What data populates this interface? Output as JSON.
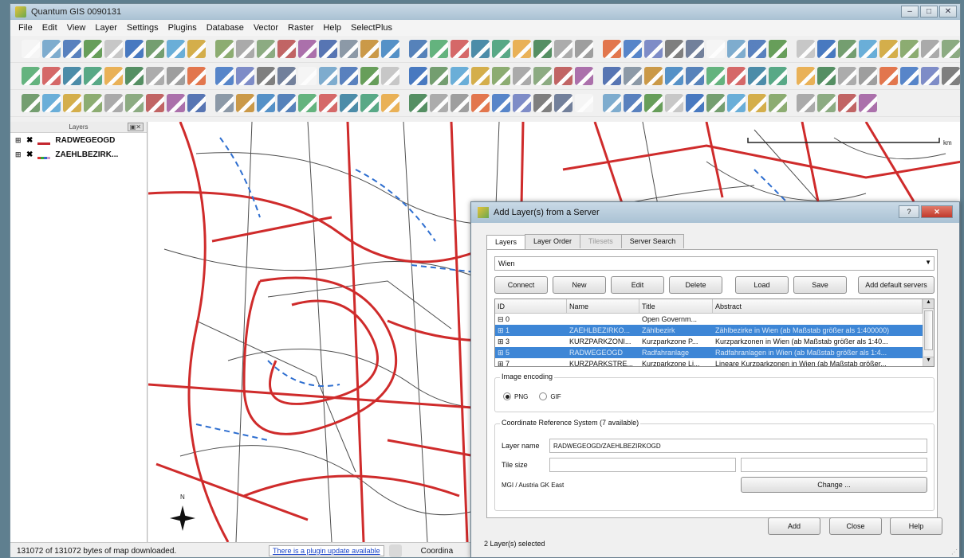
{
  "window": {
    "title": "Quantum GIS 0090131",
    "controls": [
      "–",
      "□",
      "✕"
    ]
  },
  "menu": [
    "File",
    "Edit",
    "View",
    "Layer",
    "Settings",
    "Plugins",
    "Database",
    "Vector",
    "Raster",
    "Help",
    "SelectPlus"
  ],
  "toolbar_colors": [
    "#f6f6f6",
    "#e8a63c",
    "#3c5fa8",
    "#2b64b8",
    "#3c72c2",
    "#4ba86a",
    "#9e9e9e",
    "#6aa0c8",
    "#3a7e4a",
    "#7a8a9a",
    "#5e8f5a",
    "#6a7ac0",
    "#d05050",
    "#7b9f6e",
    "#3e6db5",
    "#a0a0a0",
    "#c48a2a",
    "#52a3d4",
    "#6b6b6b",
    "#2f7a9c",
    "#b94c4c",
    "#4f8f3f",
    "#8f8f8f",
    "#3a80c0",
    "#cfa22e",
    "#5c6c8c",
    "#3d9c73",
    "#9f5a9f",
    "#c0c0c0",
    "#e06030",
    "#3b6fb0",
    "#7ba05b"
  ],
  "layers_panel": {
    "header": "Layers",
    "items": [
      {
        "name": "RADWEGEOGD",
        "checked": true
      },
      {
        "name": "ZAEHLBEZIRK...",
        "checked": true
      }
    ]
  },
  "map": {
    "scale_unit": "km",
    "north_arrow": "N"
  },
  "status": {
    "message": "131072 of 131072 bytes of map downloaded.",
    "plugin_link": "There is a plugin update available",
    "coordinate_label": "Coordina"
  },
  "dialog": {
    "title": "Add Layer(s) from a Server",
    "tabs": [
      {
        "label": "Layers",
        "state": "active"
      },
      {
        "label": "Layer Order",
        "state": "normal"
      },
      {
        "label": "Tilesets",
        "state": "disabled"
      },
      {
        "label": "Server Search",
        "state": "normal"
      }
    ],
    "server": "Wien",
    "buttons": {
      "connect": "Connect",
      "new": "New",
      "edit": "Edit",
      "delete": "Delete",
      "load": "Load",
      "save": "Save",
      "add_default": "Add default servers"
    },
    "table": {
      "columns": [
        "ID",
        "Name",
        "Title",
        "Abstract"
      ],
      "rows": [
        {
          "id": "⊟ 0",
          "name": "",
          "title": "Open Governm...",
          "abstract": "",
          "selected": false
        },
        {
          "id": "⊞ 1",
          "name": "ZAEHLBEZIRKO...",
          "title": "Zählbezirk",
          "abstract": "Zählbezirke in Wien (ab Maßstab größer als 1:400000)",
          "selected": true
        },
        {
          "id": "⊞ 3",
          "name": "KURZPARKZONI...",
          "title": "Kurzparkzone P...",
          "abstract": "Kurzparkzonen in Wien (ab Maßstab größer als 1:40...",
          "selected": false
        },
        {
          "id": "⊞ 5",
          "name": "RADWEGEOGD",
          "title": "Radfahranlage",
          "abstract": "Radfahranlagen in Wien (ab Maßstab größer als 1:4...",
          "selected": true
        },
        {
          "id": "⊞ 7",
          "name": "KURZPARKSTRE...",
          "title": "Kurzparkzone Li...",
          "abstract": "Lineare Kurzparkzonen in Wien (ab Maßstab größer...",
          "selected": false
        }
      ]
    },
    "image_encoding": {
      "label": "Image encoding",
      "options": [
        {
          "label": "PNG",
          "checked": true
        },
        {
          "label": "GIF",
          "checked": false
        }
      ]
    },
    "crs": {
      "label": "Coordinate Reference System (7 available)",
      "layer_name_label": "Layer name",
      "layer_name_value": "RADWEGEOGD/ZAEHLBEZIRKOGD",
      "tile_size_label": "Tile size",
      "crs_value": "MGI / Austria GK East",
      "change_button": "Change ..."
    },
    "footer_buttons": {
      "add": "Add",
      "close": "Close",
      "help": "Help"
    },
    "status": "2 Layer(s) selected"
  }
}
